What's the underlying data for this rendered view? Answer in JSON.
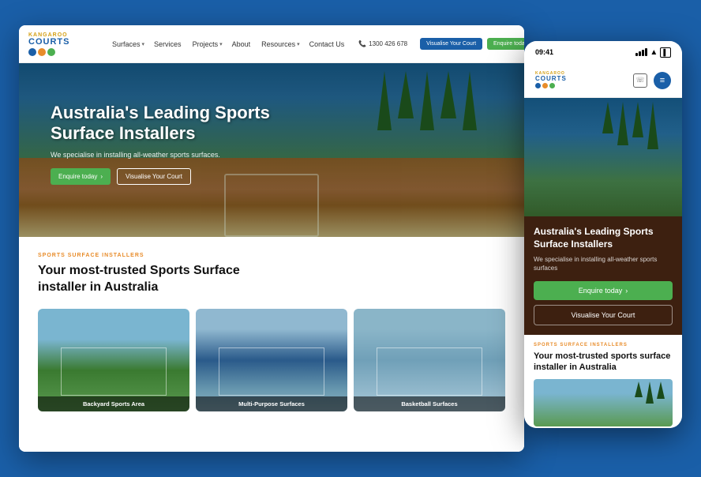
{
  "page": {
    "background_color": "#1a5fa8"
  },
  "desktop": {
    "nav": {
      "logo": {
        "kangaroo": "KANGAROO",
        "courts": "COURTS"
      },
      "links": [
        {
          "label": "Surfaces",
          "has_arrow": true
        },
        {
          "label": "Services",
          "has_arrow": false
        },
        {
          "label": "Projects",
          "has_arrow": true
        },
        {
          "label": "About",
          "has_arrow": false
        },
        {
          "label": "Resources",
          "has_arrow": true
        },
        {
          "label": "Contact Us",
          "has_arrow": false
        }
      ],
      "phone": "1300 426 678",
      "btn_visualise": "Visualise Your Court",
      "btn_enquire": "Enquire today"
    },
    "hero": {
      "title": "Australia's Leading Sports Surface Installers",
      "subtitle": "We specialise in installing all-weather sports surfaces.",
      "btn_enquire": "Enquire today",
      "btn_visualise": "Visualise Your Court"
    },
    "content": {
      "label": "SPORTS SURFACE INSTALLERS",
      "title": "Your most-trusted Sports Surface installer in Australia",
      "images": [
        {
          "label": "Backyard Sports Area"
        },
        {
          "label": "Multi-Purpose Surfaces"
        },
        {
          "label": "Basketball Surfaces"
        }
      ]
    }
  },
  "mobile": {
    "status": {
      "time": "09:41"
    },
    "nav": {
      "kangaroo": "KANGAROO",
      "courts": "COURTS"
    },
    "hero": {
      "title": "Australia's Leading Sports Surface Installers",
      "subtitle": "We specialise in installing all-weather sports surfaces",
      "btn_enquire": "Enquire today",
      "btn_visualise": "Visualise Your Court"
    },
    "content": {
      "label": "SPORTS SURFACE INSTALLERS",
      "title": "Your most-trusted sports surface installer in Australia"
    }
  }
}
